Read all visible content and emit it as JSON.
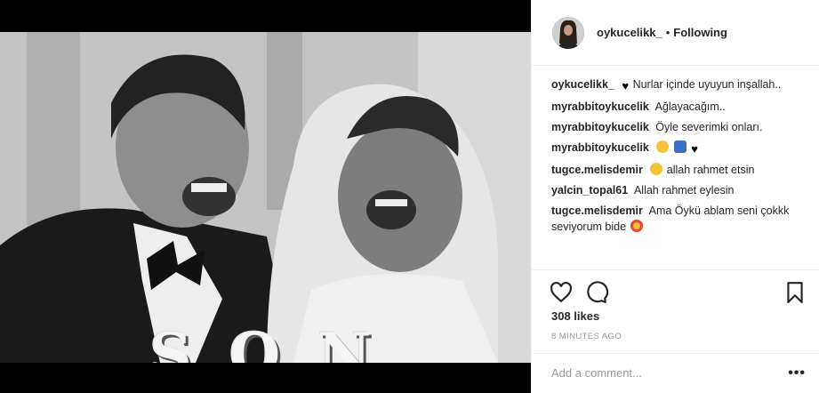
{
  "post": {
    "username": "oykucelikk_",
    "separator": "•",
    "follow_status": "Following",
    "image_overlay_letters": [
      "S",
      "O",
      "N"
    ]
  },
  "comments": [
    {
      "user": "oykucelikk_",
      "text": "Nurlar içinde uyuyun inşallah..",
      "prefix_emoji": "black-heart"
    },
    {
      "user": "myrabbitoykucelik",
      "text": "Ağlayacağım.."
    },
    {
      "user": "myrabbitoykucelik",
      "text": "Öyle severimki onları."
    },
    {
      "user": "myrabbitoykucelik",
      "text": "",
      "emojis": [
        "loudly-crying-face",
        "person-bowing",
        "black-heart"
      ]
    },
    {
      "user": "tugce.melisdemir",
      "text": "allah rahmet etsin",
      "prefix_emoji": "disappointed-face"
    },
    {
      "user": "yalcin_topal61",
      "text": "Allah rahmet eylesin"
    },
    {
      "user": "tugce.melisdemir",
      "text": "Ama Öykü ablam seni çokkk seviyorum bide",
      "suffix_emoji": "heart-eyes-face"
    }
  ],
  "stats": {
    "likes": "308 likes",
    "timestamp": "8 MINUTES AGO"
  },
  "composer": {
    "placeholder": "Add a comment...",
    "more_label": "•••"
  },
  "icons": {
    "like": "heart-outline-icon",
    "comment": "speech-bubble-icon",
    "save": "bookmark-icon"
  }
}
